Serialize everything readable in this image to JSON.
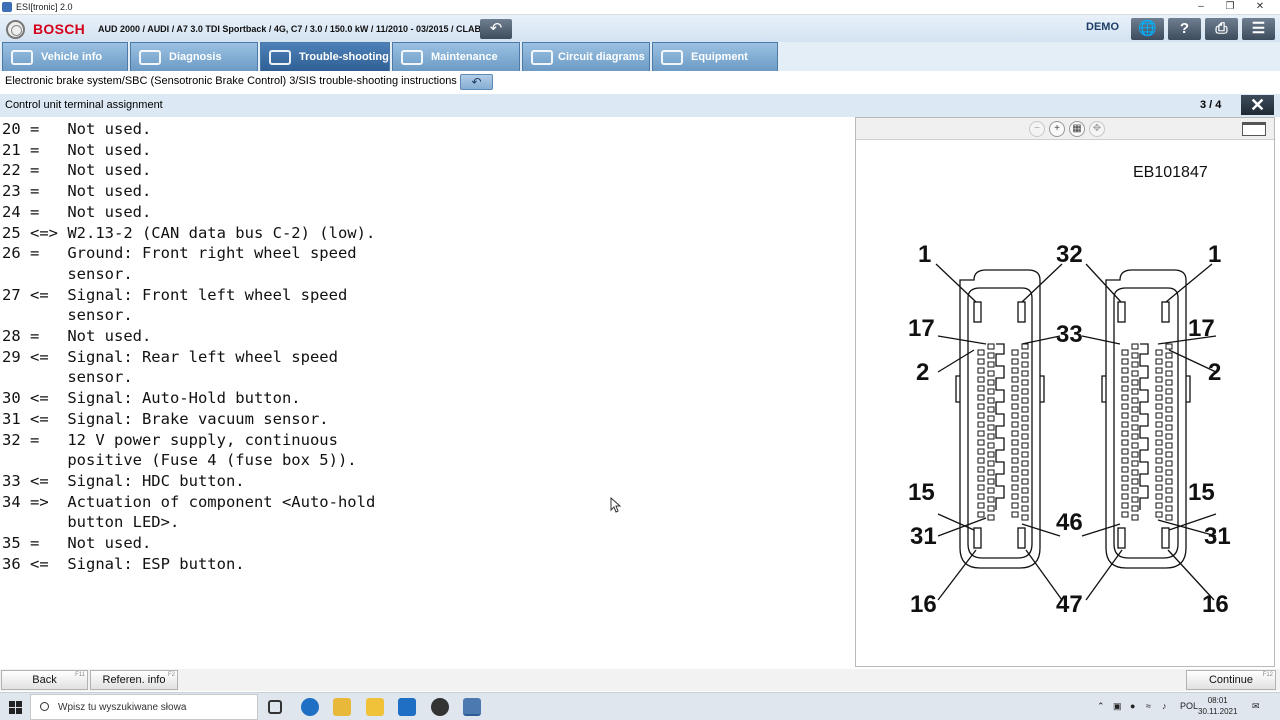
{
  "window": {
    "title": "ESI[tronic] 2.0"
  },
  "header": {
    "brand": "BOSCH",
    "vehicle": "AUD 2000 / AUDI / A7 3.0 TDI Sportback / 4G, C7 / 3.0 / 150.0 kW / 11/2010 - 03/2015 / CLAB",
    "mode": "DEMO"
  },
  "tabs": [
    {
      "label": "Vehicle info",
      "icon": "car-icon"
    },
    {
      "label": "Diagnosis",
      "icon": "diagnosis-icon"
    },
    {
      "label": "Trouble-shooting",
      "icon": "troubleshooting-icon",
      "active": true
    },
    {
      "label": "Maintenance",
      "icon": "wrench-icon"
    },
    {
      "label": "Circuit diagrams",
      "icon": "circuit-icon"
    },
    {
      "label": "Equipment",
      "icon": "book-icon"
    }
  ],
  "breadcrumb": "Electronic brake system/SBC (Sensotronic Brake Control) 3/SIS trouble-shooting instructions",
  "section": {
    "title": "Control unit terminal assignment",
    "page": "3 / 4"
  },
  "lines": [
    "20 =   Not used.",
    "21 =   Not used.",
    "22 =   Not used.",
    "23 =   Not used.",
    "24 =   Not used.",
    "25 <=> W2.13-2 (CAN data bus C-2) (low).",
    "26 =   Ground: Front right wheel speed",
    "       sensor.",
    "27 <=  Signal: Front left wheel speed",
    "       sensor.",
    "28 =   Not used.",
    "29 <=  Signal: Rear left wheel speed",
    "       sensor.",
    "30 <=  Signal: Auto-Hold button.",
    "31 <=  Signal: Brake vacuum sensor.",
    "32 =   12 V power supply, continuous",
    "       positive (Fuse 4 (fuse box 5)).",
    "33 <=  Signal: HDC button.",
    "34 =>  Actuation of component <Auto-hold",
    "       button LED>.",
    "35 =   Not used.",
    "36 <=  Signal: ESP button."
  ],
  "figure": {
    "id": "EB101847",
    "labels": {
      "a1": "1",
      "a32": "32",
      "b1": "1",
      "a17": "17",
      "a33": "33",
      "b17": "17",
      "a2": "2",
      "b2": "2",
      "a15": "15",
      "b15": "15",
      "a46": "46",
      "a31": "31",
      "b31": "31",
      "a16": "16",
      "a47": "47",
      "b16": "16"
    }
  },
  "footer": {
    "back": "Back",
    "back_key": "F11",
    "referen": "Referen. info",
    "referen_key": "F2",
    "continue": "Continue",
    "continue_key": "F12"
  },
  "taskbar": {
    "search_placeholder": "Wpisz tu wyszukiwane słowa",
    "language": "POL",
    "time": "08:01",
    "date": "30.11.2021"
  }
}
